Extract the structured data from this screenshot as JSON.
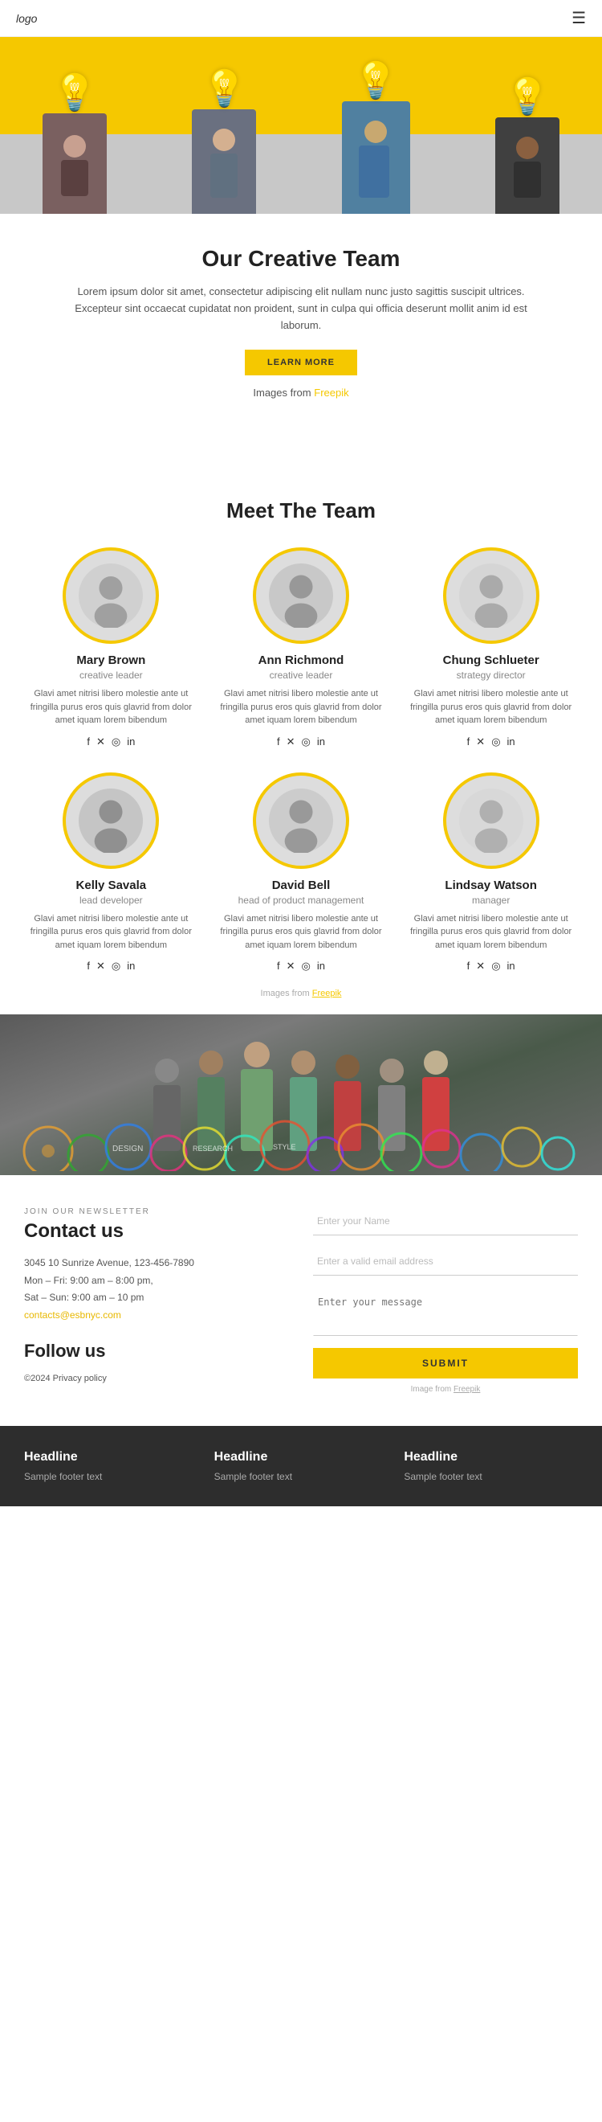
{
  "header": {
    "logo": "logo",
    "menu_icon": "☰"
  },
  "hero": {
    "section_bg": "#f5c800"
  },
  "creative_team": {
    "title": "Our Creative Team",
    "description": "Lorem ipsum dolor sit amet, consectetur adipiscing elit nullam nunc justo sagittis suscipit ultrices. Excepteur sint occaecat cupidatat non proident, sunt in culpa qui officia deserunt mollit anim id est laborum.",
    "button_label": "LEARN MORE",
    "credit_text": "Images from",
    "credit_link": "Freepik"
  },
  "meet_team": {
    "title": "Meet The Team",
    "credit_text": "Images from",
    "credit_link": "Freepik",
    "members": [
      {
        "name": "Mary Brown",
        "role": "creative leader",
        "bio": "Glavi amet nitrisi libero molestie ante ut fringilla purus eros quis glavrid from dolor amet iquam lorem bibendum",
        "socials": [
          "f",
          "tw",
          "ig",
          "in"
        ]
      },
      {
        "name": "Ann Richmond",
        "role": "creative leader",
        "bio": "Glavi amet nitrisi libero molestie ante ut fringilla purus eros quis glavrid from dolor amet iquam lorem bibendum",
        "socials": [
          "f",
          "tw",
          "ig",
          "in"
        ]
      },
      {
        "name": "Chung Schlueter",
        "role": "strategy director",
        "bio": "Glavi amet nitrisi libero molestie ante ut fringilla purus eros quis glavrid from dolor amet iquam lorem bibendum",
        "socials": [
          "f",
          "tw",
          "ig",
          "in"
        ]
      },
      {
        "name": "Kelly Savala",
        "role": "lead developer",
        "bio": "Glavi amet nitrisi libero molestie ante ut fringilla purus eros quis glavrid from dolor amet iquam lorem bibendum",
        "socials": [
          "f",
          "tw",
          "ig",
          "in"
        ]
      },
      {
        "name": "David Bell",
        "role": "head of product management",
        "bio": "Glavi amet nitrisi libero molestie ante ut fringilla purus eros quis glavrid from dolor amet iquam lorem bibendum",
        "socials": [
          "f",
          "tw",
          "ig",
          "in"
        ]
      },
      {
        "name": "Lindsay Watson",
        "role": "manager",
        "bio": "Glavi amet nitrisi libero molestie ante ut fringilla purus eros quis glavrid from dolor amet iquam lorem bibendum",
        "socials": [
          "f",
          "tw",
          "ig",
          "in"
        ]
      }
    ]
  },
  "contact": {
    "newsletter_label": "JOIN OUR NEWSLETTER",
    "title": "Contact us",
    "address": "3045 10 Sunrize Avenue, 123-456-7890",
    "hours1": "Mon – Fri: 9:00 am – 8:00 pm,",
    "hours2": "Sat – Sun: 9:00 am – 10 pm",
    "email": "contacts@esbnyc.com",
    "follow_title": "Follow us",
    "copyright": "©2024 Privacy policy"
  },
  "form": {
    "name_placeholder": "Enter your Name",
    "email_placeholder": "Enter a valid email address",
    "message_placeholder": "Enter your message",
    "submit_label": "SUBMIT",
    "credit_text": "Image from",
    "credit_link": "Freepik"
  },
  "footer": {
    "columns": [
      {
        "headline": "Headline",
        "text": "Sample footer text"
      },
      {
        "headline": "Headline",
        "text": "Sample footer text"
      },
      {
        "headline": "Headline",
        "text": "Sample footer text"
      }
    ]
  }
}
